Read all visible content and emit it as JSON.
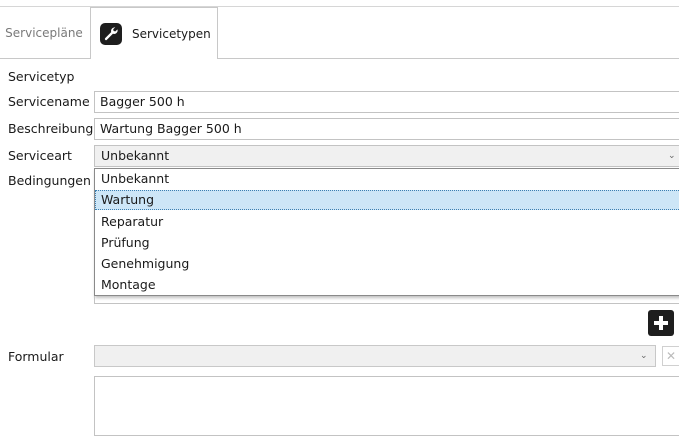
{
  "tabs": [
    {
      "label": "Servicepläne",
      "active": false
    },
    {
      "label": "Servicetypen",
      "active": true,
      "icon": "wrench-icon"
    }
  ],
  "form": {
    "section_label": "Servicetyp",
    "name_label": "Servicename",
    "name_value": "Bagger 500 h",
    "description_label": "Beschreibung",
    "description_value": "Wartung Bagger 500 h",
    "type_label": "Serviceart",
    "type_value": "Unbekannt",
    "conditions_label": "Bedingungen",
    "form_label": "Formular",
    "form_value": ""
  },
  "dropdown": {
    "options": [
      "Unbekannt",
      "Wartung",
      "Reparatur",
      "Prüfung",
      "Genehmigung",
      "Montage"
    ],
    "highlighted": "Wartung"
  },
  "colors": {
    "highlight": "#cde6f7",
    "button_dark": "#1e1e1e",
    "combo_bg": "#f0f0f0"
  }
}
